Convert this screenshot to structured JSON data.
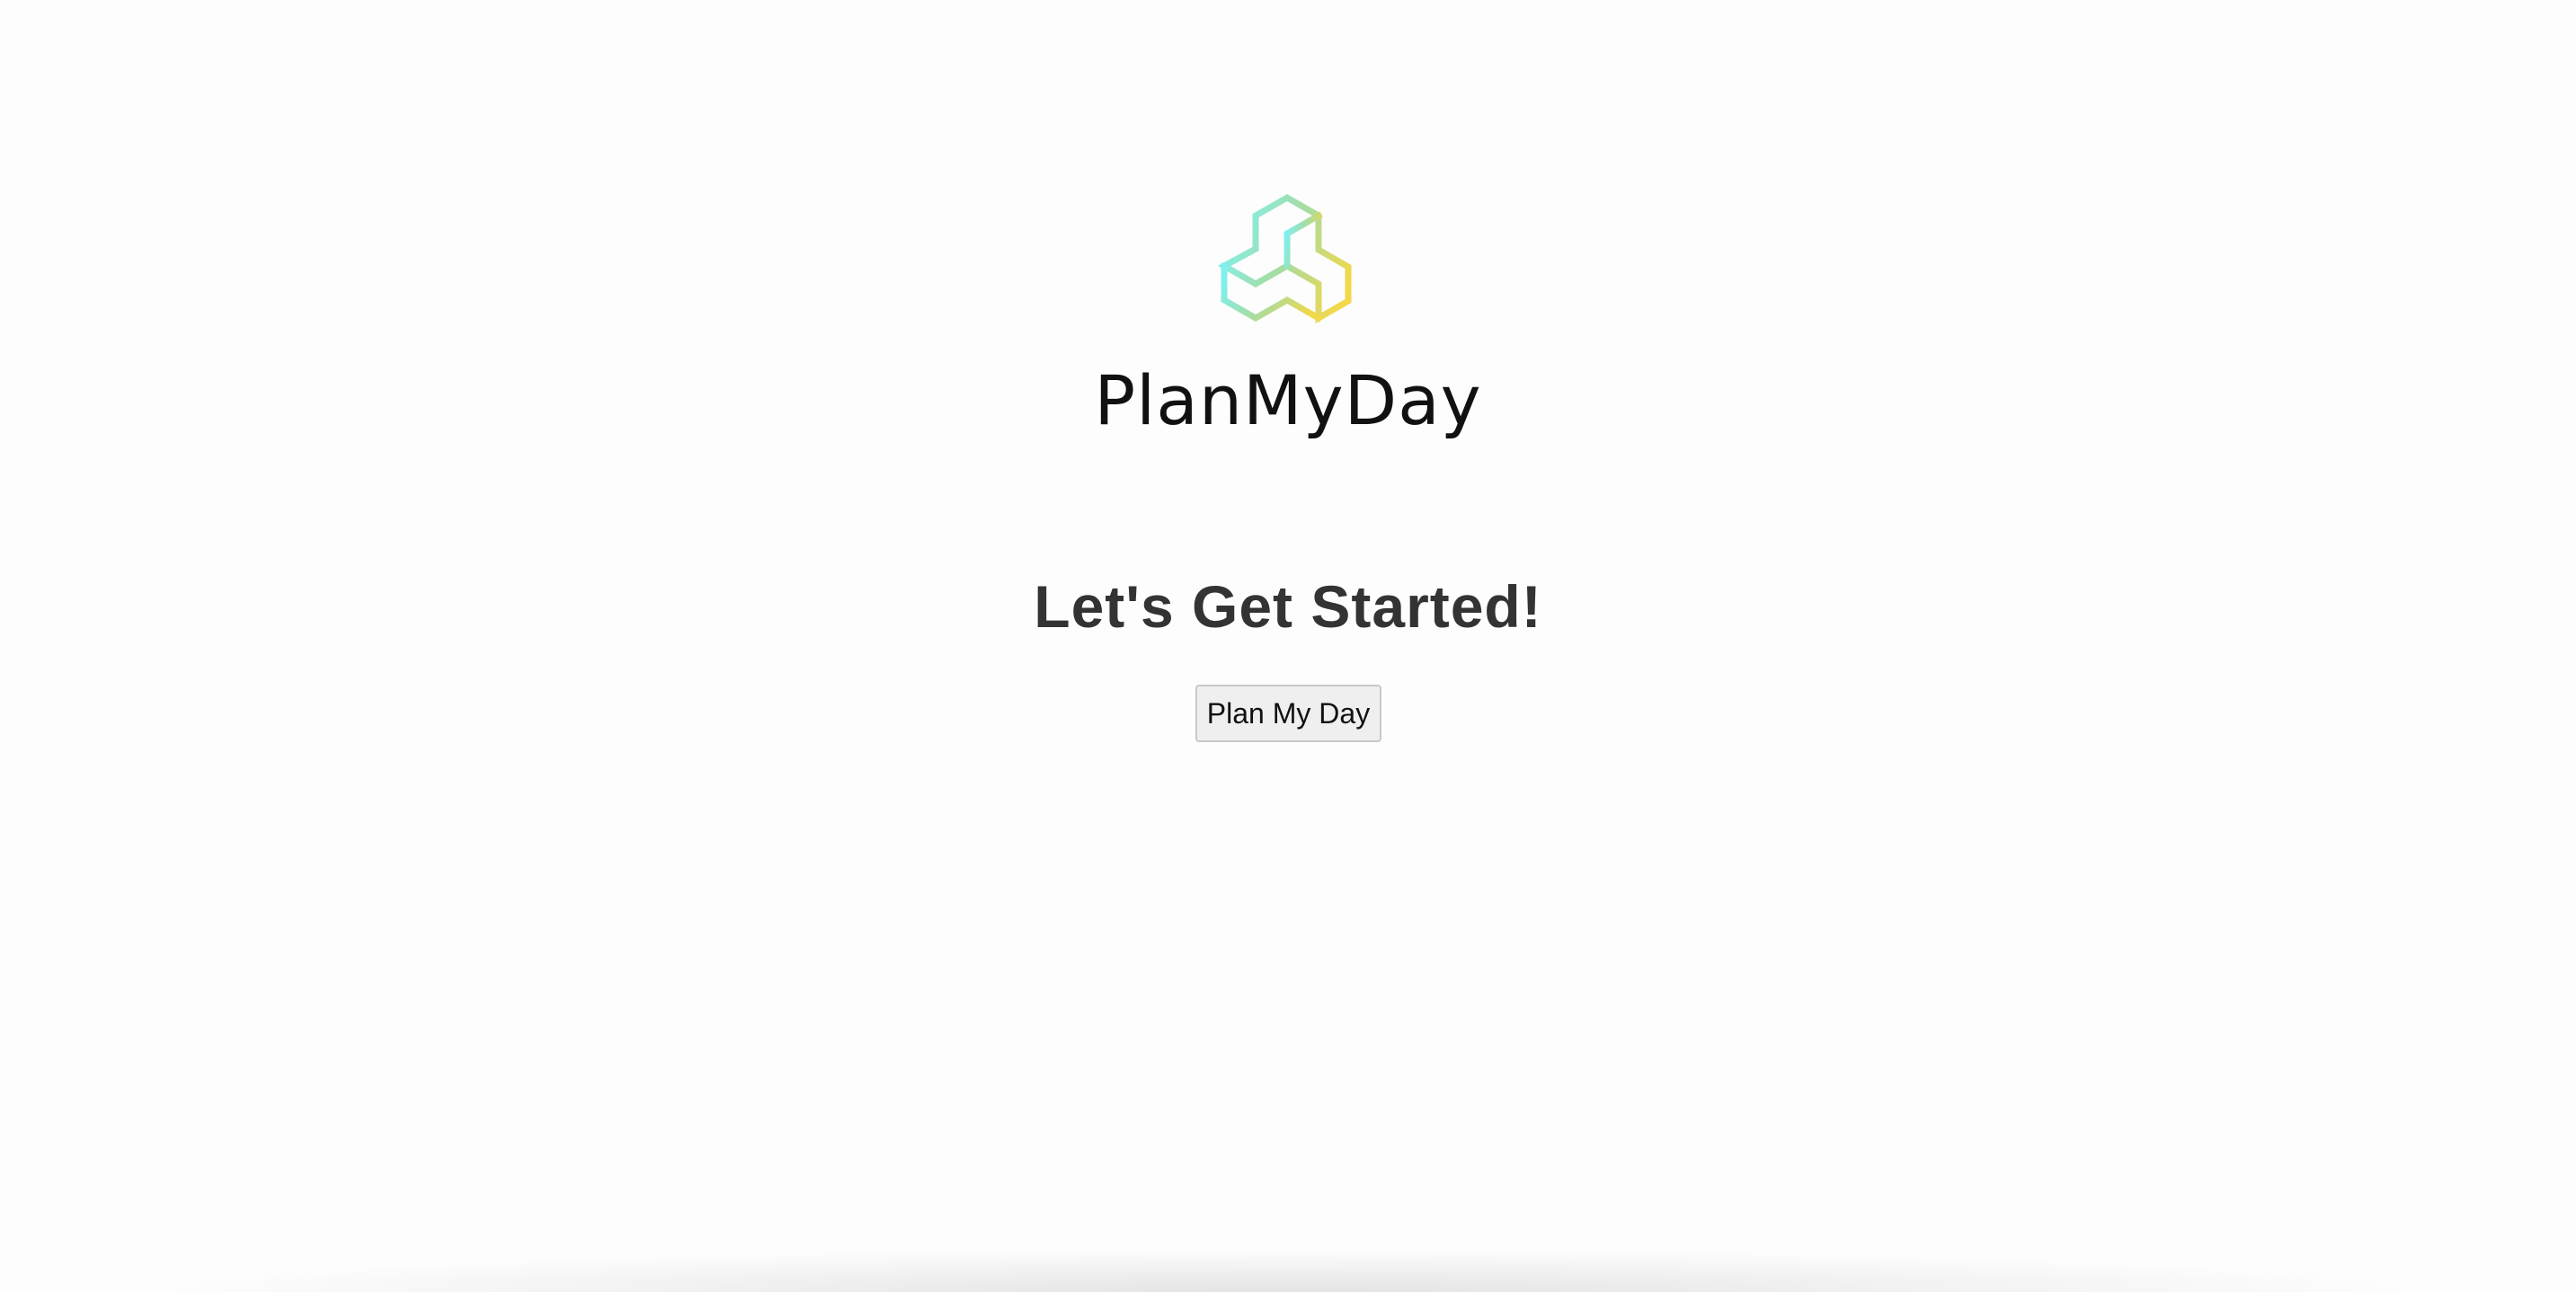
{
  "brand": {
    "logo_icon": "hexagon-cluster-logo-icon",
    "name": "PlanMyDay"
  },
  "main": {
    "headline": "Let's Get Started!",
    "cta_label": "Plan My Day"
  },
  "colors": {
    "logo_gradient_start": "#7ff0ee",
    "logo_gradient_mid": "#a8dca0",
    "logo_gradient_end": "#f2d84a",
    "headline": "#333333",
    "brand_text": "#111111",
    "button_bg": "#efefef",
    "button_border": "#c8c8c8"
  }
}
